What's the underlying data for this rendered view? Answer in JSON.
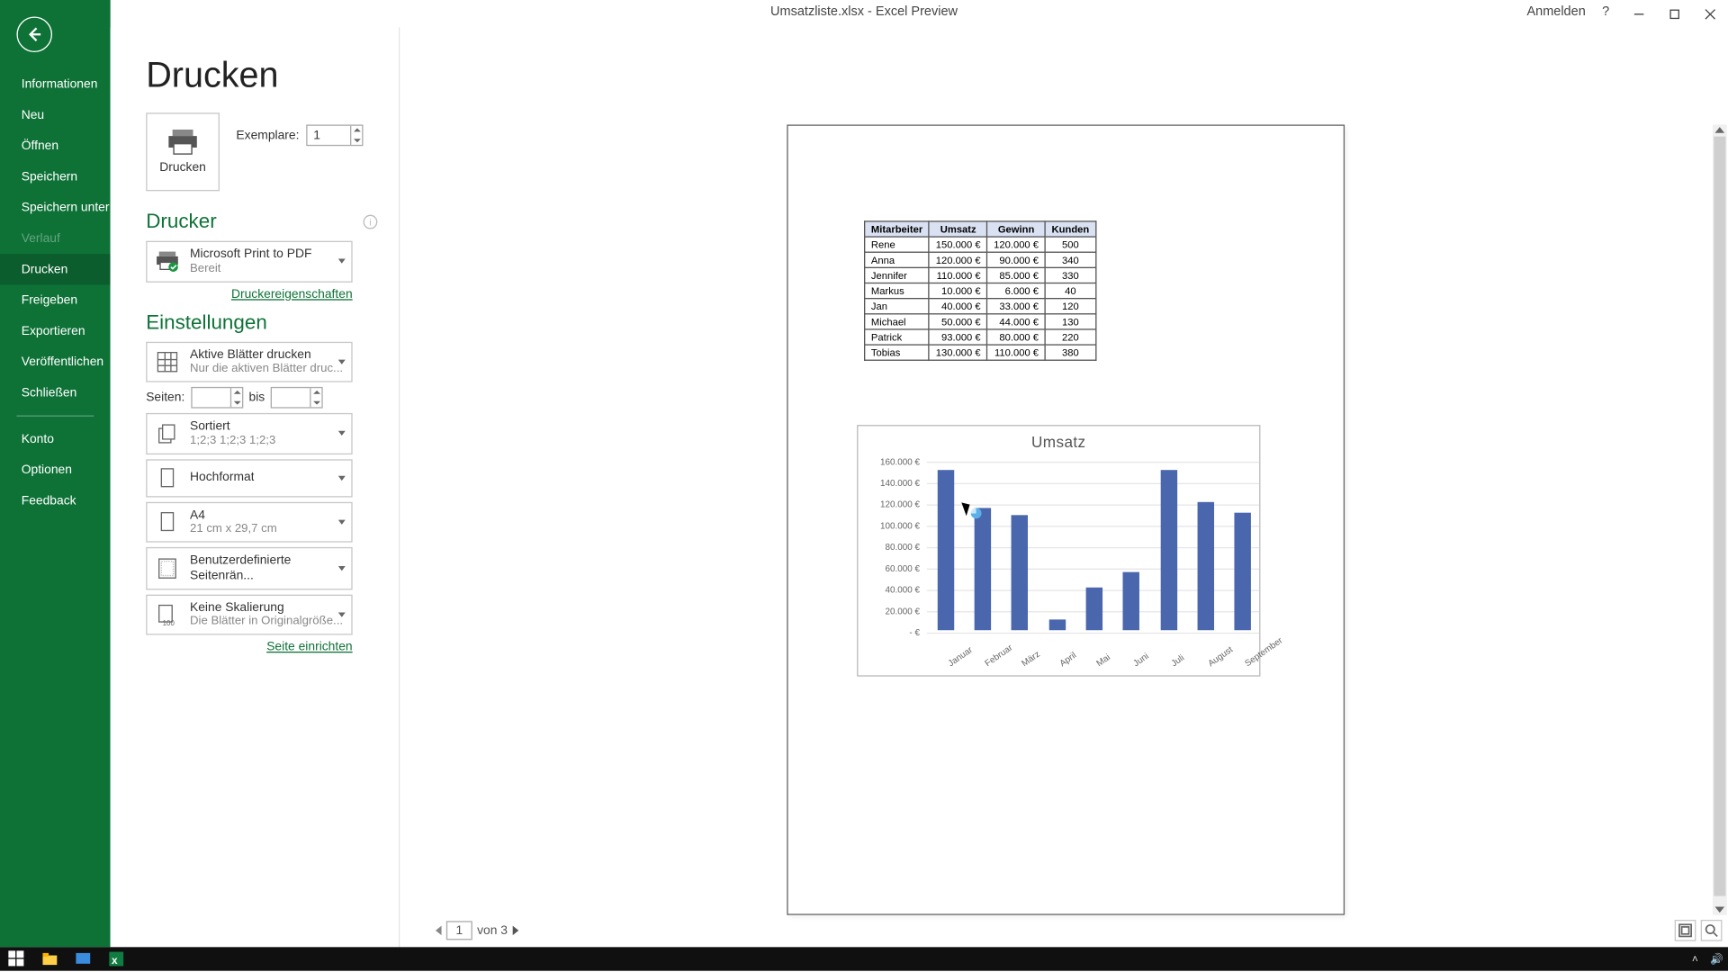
{
  "title": "Umsatzliste.xlsx - Excel Preview",
  "signin": "Anmelden",
  "sidebar": {
    "items": [
      {
        "label": "Informationen"
      },
      {
        "label": "Neu"
      },
      {
        "label": "Öffnen"
      },
      {
        "label": "Speichern"
      },
      {
        "label": "Speichern unter"
      },
      {
        "label": "Verlauf",
        "disabled": true
      },
      {
        "label": "Drucken",
        "active": true
      },
      {
        "label": "Freigeben"
      },
      {
        "label": "Exportieren"
      },
      {
        "label": "Veröffentlichen"
      },
      {
        "label": "Schließen"
      }
    ],
    "bottom": [
      {
        "label": "Konto"
      },
      {
        "label": "Optionen"
      },
      {
        "label": "Feedback"
      }
    ]
  },
  "panel": {
    "heading": "Drucken",
    "print_button": "Drucken",
    "copies_label": "Exemplare:",
    "copies_value": "1",
    "printer_heading": "Drucker",
    "printer_name": "Microsoft Print to PDF",
    "printer_status": "Bereit",
    "printer_props_link": "Druckereigenschaften",
    "settings_heading": "Einstellungen",
    "setting_sheets": "Aktive Blätter drucken",
    "setting_sheets_sub": "Nur die aktiven Blätter druc...",
    "pages_label": "Seiten:",
    "pages_to": "bis",
    "setting_collate": "Sortiert",
    "setting_collate_sub": "1;2;3    1;2;3    1;2;3",
    "setting_orient": "Hochformat",
    "setting_paper": "A4",
    "setting_paper_sub": "21 cm x 29,7 cm",
    "setting_margin": "Benutzerdefinierte Seitenrän...",
    "setting_scale": "Keine Skalierung",
    "setting_scale_sub": "Die Blätter in Originalgröße...",
    "page_setup_link": "Seite einrichten"
  },
  "pagenav": {
    "current": "1",
    "of_label": "von 3"
  },
  "preview_table": {
    "headers": [
      "Mitarbeiter",
      "Umsatz",
      "Gewinn",
      "Kunden"
    ],
    "rows": [
      [
        "Rene",
        "150.000 €",
        "120.000 €",
        "500"
      ],
      [
        "Anna",
        "120.000 €",
        "90.000 €",
        "340"
      ],
      [
        "Jennifer",
        "110.000 €",
        "85.000 €",
        "330"
      ],
      [
        "Markus",
        "10.000 €",
        "6.000 €",
        "40"
      ],
      [
        "Jan",
        "40.000 €",
        "33.000 €",
        "120"
      ],
      [
        "Michael",
        "50.000 €",
        "44.000 €",
        "130"
      ],
      [
        "Patrick",
        "93.000 €",
        "80.000 €",
        "220"
      ],
      [
        "Tobias",
        "130.000 €",
        "110.000 €",
        "380"
      ]
    ]
  },
  "chart_data": {
    "type": "bar",
    "title": "Umsatz",
    "categories": [
      "Januar",
      "Februar",
      "März",
      "April",
      "Mai",
      "Juni",
      "Juli",
      "August",
      "September"
    ],
    "values": [
      150000,
      115000,
      108000,
      10000,
      40000,
      55000,
      150000,
      120000,
      110000
    ],
    "ylim": [
      0,
      160000
    ],
    "yticks": [
      "160.000 €",
      "140.000 €",
      "120.000 €",
      "100.000 €",
      "80.000 €",
      "60.000 €",
      "40.000 €",
      "20.000 €",
      "-   €"
    ],
    "ylabel": "",
    "xlabel": ""
  }
}
